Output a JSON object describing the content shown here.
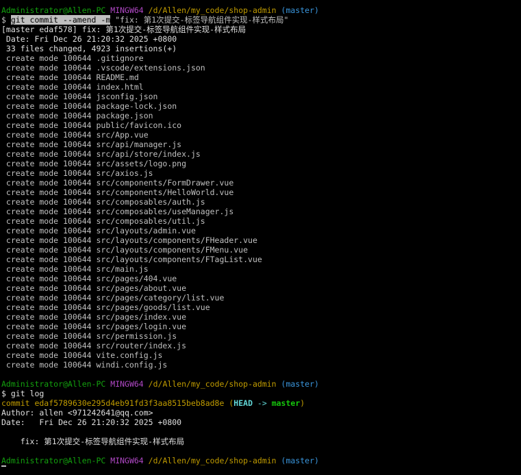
{
  "prompt1": {
    "user": "Administrator@Allen-PC",
    "sys": "MINGW64",
    "path": "/d/Allen/my_code/shop-admin",
    "branch": "(master)"
  },
  "cmd1": {
    "dollar": "$ ",
    "selected": "git commit --amend -m",
    "rest": " \"fix: 第1次提交-标签导航组件实现-样式布局\""
  },
  "commit_out": {
    "summary": "[master edaf578] fix: 第1次提交-标签导航组件实现-样式布局",
    "date": " Date: Fri Dec 26 21:20:32 2025 +0800",
    "stats": " 33 files changed, 4923 insertions(+)",
    "files": [
      " create mode 100644 .gitignore",
      " create mode 100644 .vscode/extensions.json",
      " create mode 100644 README.md",
      " create mode 100644 index.html",
      " create mode 100644 jsconfig.json",
      " create mode 100644 package-lock.json",
      " create mode 100644 package.json",
      " create mode 100644 public/favicon.ico",
      " create mode 100644 src/App.vue",
      " create mode 100644 src/api/manager.js",
      " create mode 100644 src/api/store/index.js",
      " create mode 100644 src/assets/logo.png",
      " create mode 100644 src/axios.js",
      " create mode 100644 src/components/FormDrawer.vue",
      " create mode 100644 src/components/HelloWorld.vue",
      " create mode 100644 src/composables/auth.js",
      " create mode 100644 src/composables/useManager.js",
      " create mode 100644 src/composables/util.js",
      " create mode 100644 src/layouts/admin.vue",
      " create mode 100644 src/layouts/components/FHeader.vue",
      " create mode 100644 src/layouts/components/FMenu.vue",
      " create mode 100644 src/layouts/components/FTagList.vue",
      " create mode 100644 src/main.js",
      " create mode 100644 src/pages/404.vue",
      " create mode 100644 src/pages/about.vue",
      " create mode 100644 src/pages/category/list.vue",
      " create mode 100644 src/pages/goods/list.vue",
      " create mode 100644 src/pages/index.vue",
      " create mode 100644 src/pages/login.vue",
      " create mode 100644 src/permission.js",
      " create mode 100644 src/router/index.js",
      " create mode 100644 vite.config.js",
      " create mode 100644 windi.config.js"
    ]
  },
  "prompt2": {
    "user": "Administrator@Allen-PC",
    "sys": "MINGW64",
    "path": "/d/Allen/my_code/shop-admin",
    "branch": "(master)"
  },
  "cmd2": "$ git log",
  "log": {
    "commit_label": "commit edaf5789630e295d4eb91fd3f3aa8515beb8ad8e",
    "paren_open": "(",
    "head": "HEAD",
    "arrow": " -> ",
    "master": "master",
    "paren_close": ")",
    "author": "Author: allen <971242641@qq.com>",
    "date": "Date:   Fri Dec 26 21:20:32 2025 +0800",
    "message": "    fix: 第1次提交-标签导航组件实现-样式布局"
  },
  "prompt3": {
    "user": "Administrator@Allen-PC",
    "sys": "MINGW64",
    "path": "/d/Allen/my_code/shop-admin",
    "branch": "(master)"
  },
  "colors": {
    "background": "#000000",
    "text": "#c0c0c0",
    "user": "#13a10e",
    "system": "#b148c6",
    "path": "#c19c00",
    "branch": "#3a96dd",
    "commit_hash": "#c19c00",
    "head": "#61d6d6",
    "master": "#16c60c"
  }
}
